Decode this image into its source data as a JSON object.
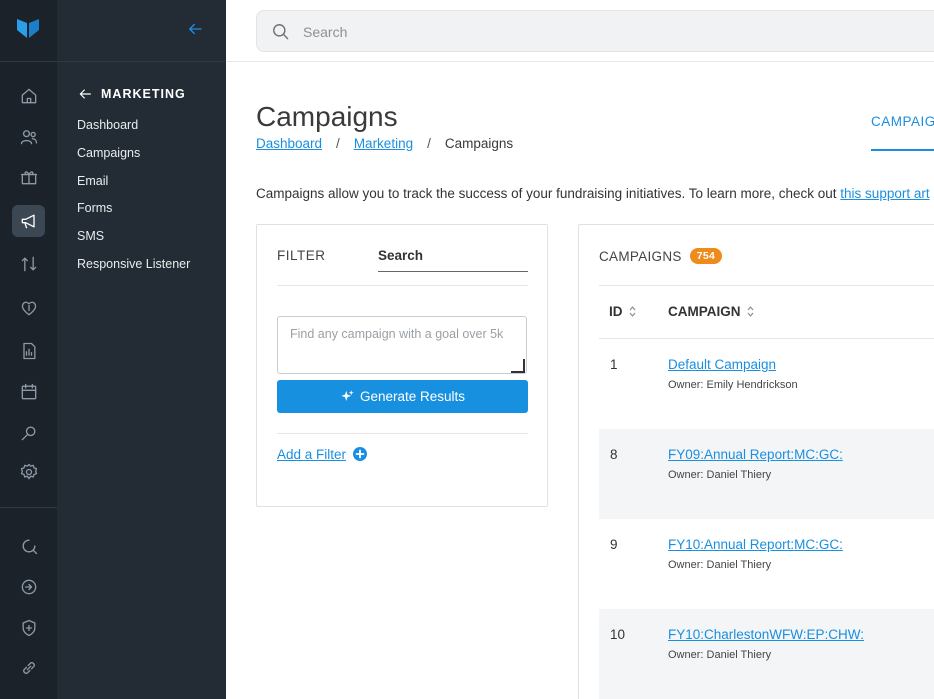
{
  "header": {
    "search_placeholder": "Search"
  },
  "subnav": {
    "section_label": "MARKETING",
    "items": [
      {
        "label": "Dashboard"
      },
      {
        "label": "Campaigns"
      },
      {
        "label": "Email"
      },
      {
        "label": "Forms"
      },
      {
        "label": "SMS"
      },
      {
        "label": "Responsive Listener"
      }
    ]
  },
  "page": {
    "title": "Campaigns",
    "breadcrumb": [
      "Dashboard",
      "Marketing",
      "Campaigns"
    ],
    "right_tab": "CAMPAIG",
    "intro_text": "Campaigns allow you to track the success of your fundraising initiatives. To learn more, check out ",
    "intro_link": "this support art"
  },
  "filter": {
    "label": "FILTER",
    "search_tab": "Search",
    "query_placeholder": "Find any campaign with a goal over 5k",
    "generate_label": "Generate Results",
    "add_filter_label": "Add a Filter"
  },
  "campaigns": {
    "label": "CAMPAIGNS",
    "count": "754",
    "columns": [
      "ID",
      "CAMPAIGN"
    ],
    "rows": [
      {
        "id": "1",
        "name": "Default Campaign",
        "owner": "Owner: Emily Hendrickson"
      },
      {
        "id": "8",
        "name": "FY09:Annual Report:MC:GC:",
        "owner": "Owner: Daniel Thiery"
      },
      {
        "id": "9",
        "name": "FY10:Annual Report:MC:GC:",
        "owner": "Owner: Daniel Thiery"
      },
      {
        "id": "10",
        "name": "FY10:CharlestonWFW:EP:CHW:",
        "owner": "Owner: Daniel Thiery"
      }
    ]
  },
  "colors": {
    "accent": "#1a8fe0",
    "rail": "#1b2229",
    "subnav": "#232c34",
    "badge": "#ef8a1c"
  },
  "rail_icons": [
    "home-icon",
    "people-icon",
    "gift-icon",
    "megaphone-icon",
    "arrows-icon",
    "donation-icon",
    "report-icon",
    "calendar-icon",
    "search-icon",
    "settings-icon",
    "search-refresh-icon",
    "sign-in-icon",
    "shield-icon",
    "link-icon"
  ]
}
